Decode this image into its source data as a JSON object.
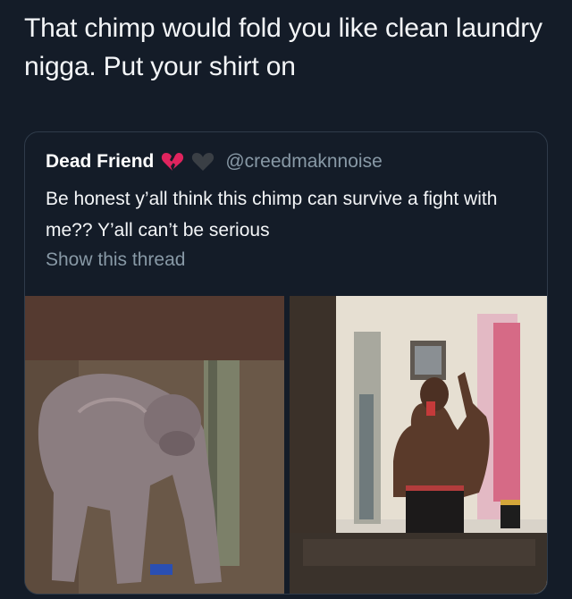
{
  "tweet": {
    "text": "That chimp would fold you like clean laundry nigga. Put your shirt on"
  },
  "quoted_tweet": {
    "display_name": "Dead Friend",
    "emojis": [
      "broken-heart-icon",
      "black-heart-icon"
    ],
    "handle": "@creedmaknnoise",
    "text": "Be honest y’all think this chimp can survive a fight with me?? Y’all can’t be serious",
    "show_thread_label": "Show this thread",
    "media": [
      "chimp-photo",
      "mirror-selfie-photo"
    ]
  },
  "colors": {
    "background": "#141c28",
    "border": "#2f3b4a",
    "secondary_text": "#8899a6",
    "broken_heart": "#e0245e",
    "black_heart": "#292f33"
  }
}
